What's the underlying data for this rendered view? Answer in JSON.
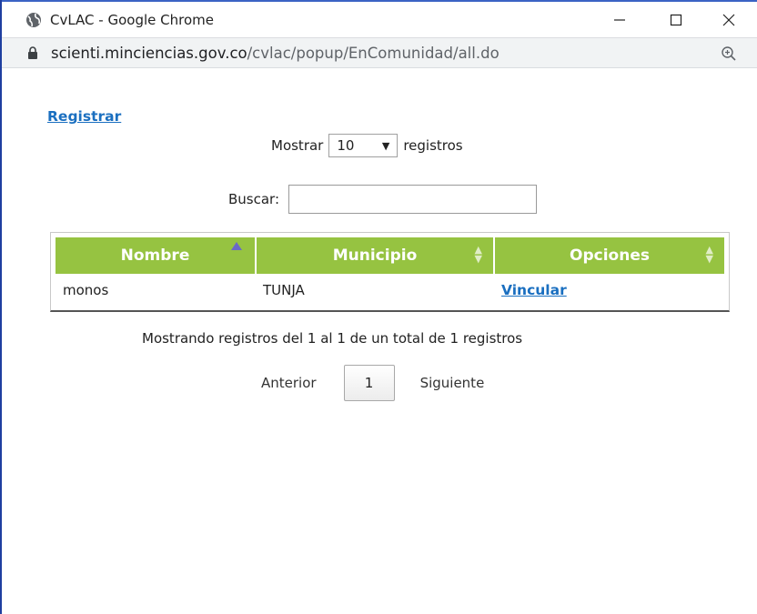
{
  "window": {
    "title": "CvLAC - Google Chrome",
    "controls": {
      "minimize": "minimize-icon",
      "maximize": "maximize-icon",
      "close": "close-icon"
    }
  },
  "address": {
    "domain": "scienti.minciencias.gov.co",
    "path": "/cvlac/popup/EnComunidad/all.do"
  },
  "page": {
    "registrar_link": "Registrar",
    "length": {
      "prefix": "Mostrar",
      "selected": "10",
      "suffix": "registros"
    },
    "search": {
      "label": "Buscar:",
      "value": ""
    },
    "table": {
      "headers": [
        "Nombre",
        "Municipio",
        "Opciones"
      ],
      "rows": [
        {
          "nombre": "monos",
          "municipio": "TUNJA",
          "opcion": "Vincular"
        }
      ]
    },
    "info": "Mostrando registros del 1 al 1 de un total de 1 registros",
    "pager": {
      "previous": "Anterior",
      "current": "1",
      "next": "Siguiente"
    }
  },
  "colors": {
    "header_bg": "#96c341",
    "link": "#1a6fc0",
    "frame_border": "#1f3fa0",
    "sort_active": "#6a68c8"
  }
}
